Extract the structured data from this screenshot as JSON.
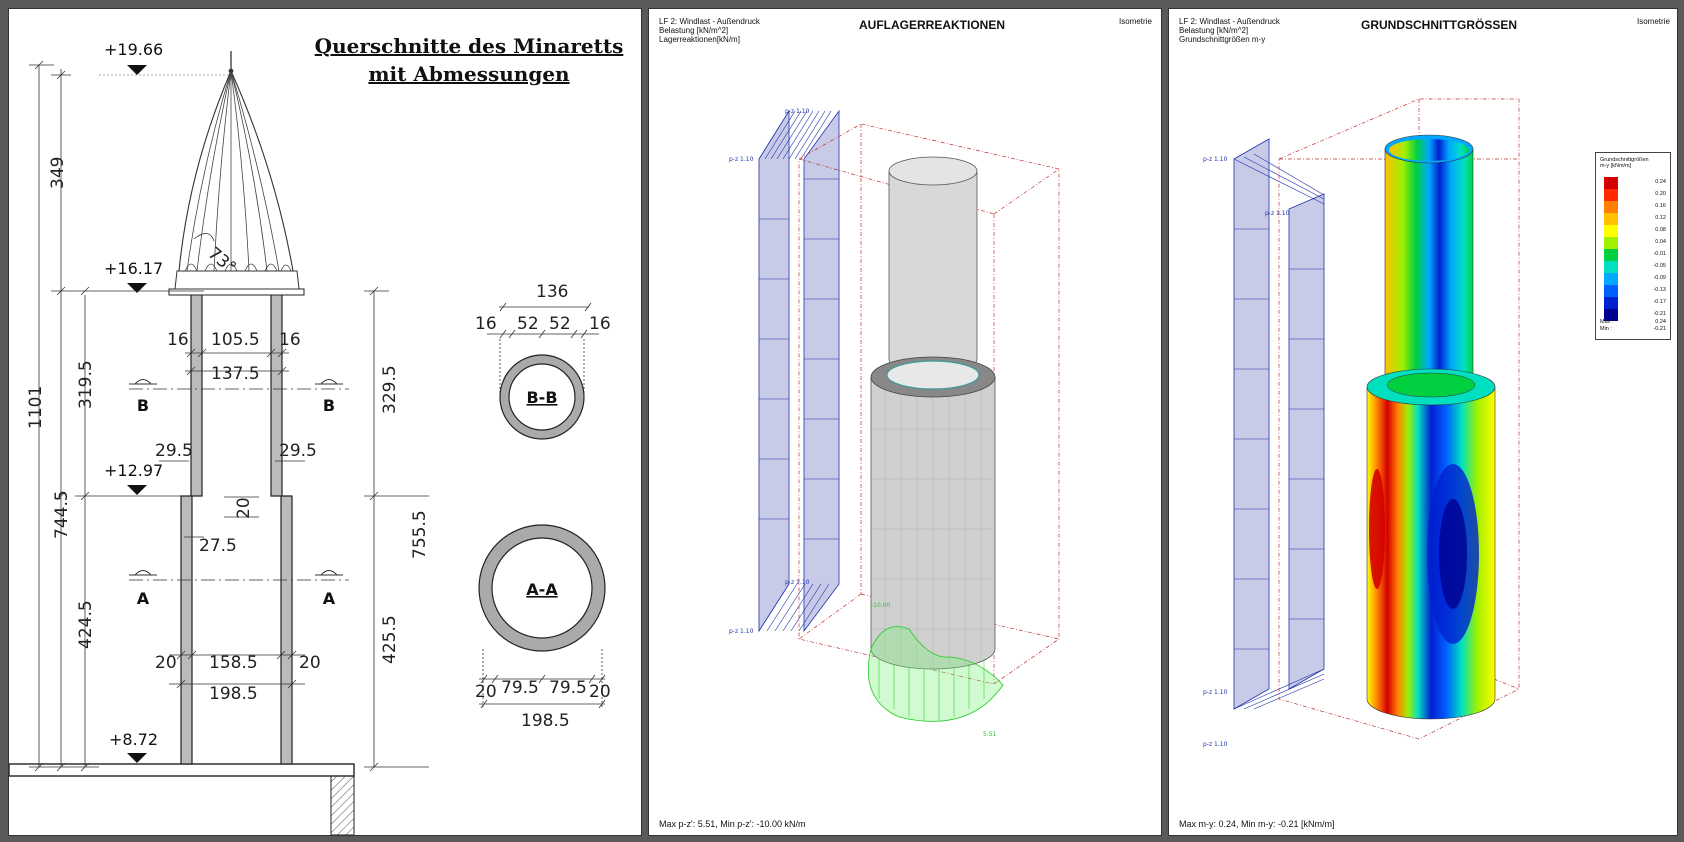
{
  "drawing": {
    "title_line1": "Querschnitte des Minaretts",
    "title_line2": "mit Abmessungen",
    "levels": [
      "+19.66",
      "+16.17",
      "+12.97",
      "+8.72"
    ],
    "heights": [
      "349",
      "1101",
      "319.5",
      "744.5",
      "424.5",
      "329.5",
      "755.5",
      "425.5"
    ],
    "upper_widths": [
      "16",
      "105.5",
      "16",
      "137.5"
    ],
    "wall_thickness": [
      "29.5",
      "29.5",
      "20",
      "27.5"
    ],
    "lower_widths": [
      "20",
      "158.5",
      "20",
      "198.5"
    ],
    "cone_angle": "73°",
    "section_marks": [
      "B",
      "B",
      "A",
      "A"
    ],
    "section_bb": {
      "label": "B-B",
      "dims": [
        "136",
        "16",
        "52",
        "52",
        "16"
      ]
    },
    "section_aa": {
      "label": "A-A",
      "dims": [
        "20",
        "79.5",
        "79.5",
        "20",
        "198.5"
      ]
    }
  },
  "panel2": {
    "header": [
      "LF 2: Windlast - Außendruck",
      "Belastung [kN/m^2]",
      "Lagerreaktionen[kN/m]"
    ],
    "title": "AUFLAGERREAKTIONEN",
    "view": "Isometrie",
    "load_labels": [
      "p-z 1.10",
      "p-z 1.10",
      "p-z 1.10",
      "p-z 1.10"
    ],
    "reaction_labels": [
      "-10.00",
      "5.51"
    ],
    "footer": "Max p-z': 5.51, Min p-z': -10.00 kN/m"
  },
  "panel3": {
    "header": [
      "LF 2: Windlast - Außendruck",
      "Belastung [kN/m^2]",
      "Grundschnittgrößen m-y"
    ],
    "title": "GRUNDSCHNITTGRÖSSEN",
    "view": "Isometrie",
    "load_labels": [
      "p-z 1.10",
      "p-z 1.10",
      "p-z 1.10",
      "p-z 1.10"
    ],
    "legend": {
      "title1": "Grundschnittgrößen",
      "title2": "m-y [kNm/m]",
      "values": [
        "0.24",
        "0.20",
        "0.16",
        "0.12",
        "0.08",
        "0.04",
        "-0.01",
        "-0.05",
        "-0.09",
        "-0.13",
        "-0.17",
        "-0.21"
      ],
      "colors": [
        "#d40000",
        "#ff2a00",
        "#ff8000",
        "#ffc000",
        "#ffff00",
        "#a0f000",
        "#00d040",
        "#00e0c0",
        "#00a8ff",
        "#0060ff",
        "#0020d0",
        "#000090"
      ],
      "max_label": "Max :",
      "max_value": "0.24",
      "min_label": "Min :",
      "min_value": "-0.21"
    },
    "footer": "Max m-y: 0.24, Min m-y: -0.21 [kNm/m]"
  }
}
